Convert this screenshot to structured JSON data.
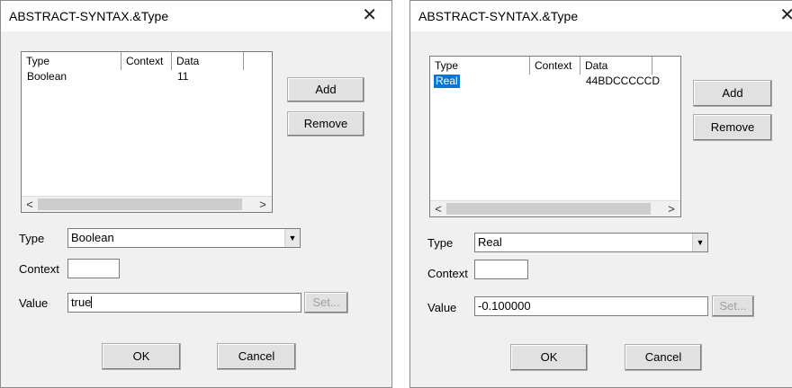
{
  "dialogs": [
    {
      "title": "ABSTRACT-SYNTAX.&Type",
      "columns": [
        "Type",
        "Context",
        "Data"
      ],
      "rows": [
        {
          "type": "Boolean",
          "context": "",
          "data": "11",
          "selected": false
        }
      ],
      "add_label": "Add",
      "remove_label": "Remove",
      "type_label": "Type",
      "type_value": "Boolean",
      "context_label": "Context",
      "context_value": "",
      "value_label": "Value",
      "value_value": "true",
      "set_label": "Set...",
      "ok_label": "OK",
      "cancel_label": "Cancel"
    },
    {
      "title": "ABSTRACT-SYNTAX.&Type",
      "columns": [
        "Type",
        "Context",
        "Data"
      ],
      "rows": [
        {
          "type": "Real",
          "context": "",
          "data": "44BDCCCCCD",
          "selected": true
        }
      ],
      "add_label": "Add",
      "remove_label": "Remove",
      "type_label": "Type",
      "type_value": "Real",
      "context_label": "Context",
      "context_value": "",
      "value_label": "Value",
      "value_value": "-0.100000",
      "set_label": "Set...",
      "ok_label": "OK",
      "cancel_label": "Cancel"
    }
  ],
  "colors": {
    "selection": "#0a76d2"
  },
  "icons": {
    "close": "close-icon",
    "dropdown": "chevron-down-icon",
    "scroll_left": "chevron-left-icon",
    "scroll_right": "chevron-right-icon"
  }
}
